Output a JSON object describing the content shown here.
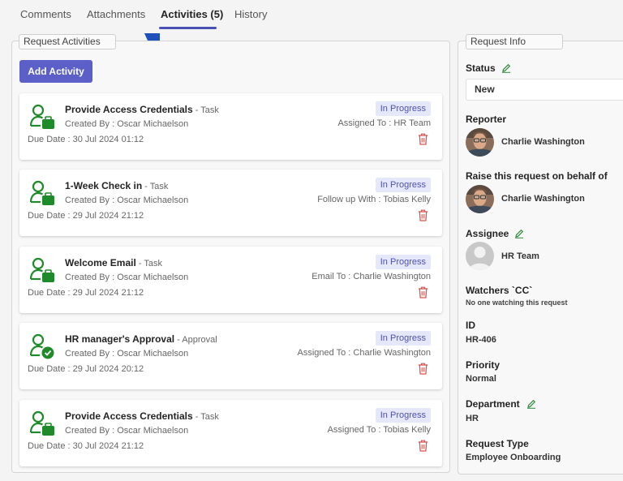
{
  "tabs": [
    {
      "label": "Comments"
    },
    {
      "label": "Attachments"
    },
    {
      "label": "Activities (5)"
    },
    {
      "label": "History"
    }
  ],
  "activities_panel": {
    "legend": "Request Activities",
    "add_button": "Add Activity",
    "items": [
      {
        "title": "Provide Access Credentials",
        "type": " - Task",
        "created": "Created By : Oscar Michaelson",
        "due": "Due Date : 30 Jul 2024 01:12",
        "status": "In Progress",
        "assign": "Assigned To : HR Team",
        "icon": "user-briefcase-icon"
      },
      {
        "title": "1-Week Check in",
        "type": " - Task",
        "created": "Created By : Oscar Michaelson",
        "due": "Due Date : 29 Jul 2024 21:12",
        "status": "In Progress",
        "assign": "Follow up With : Tobias Kelly",
        "icon": "user-briefcase-icon"
      },
      {
        "title": "Welcome Email",
        "type": " - Task",
        "created": "Created By : Oscar Michaelson",
        "due": "Due Date : 29 Jul 2024 21:12",
        "status": "In Progress",
        "assign": "Email To : Charlie Washington",
        "icon": "user-briefcase-icon"
      },
      {
        "title": "HR manager's Approval",
        "type": " - Approval",
        "created": "Created By : Oscar Michaelson",
        "due": "Due Date : 29 Jul 2024 20:12",
        "status": "In Progress",
        "assign": "Assigned To : Charlie Washington",
        "icon": "user-check-icon"
      },
      {
        "title": "Provide Access Credentials",
        "type": " - Task",
        "created": "Created By : Oscar Michaelson",
        "due": "Due Date : 30 Jul 2024 21:12",
        "status": "In Progress",
        "assign": "Assigned To : Tobias Kelly",
        "icon": "user-briefcase-icon"
      }
    ]
  },
  "request_info": {
    "legend": "Request Info",
    "status_label": "Status",
    "status_value": "New",
    "reporter_label": "Reporter",
    "reporter_name": "Charlie Washington",
    "behalf_label": "Raise this request on behalf of",
    "behalf_name": "Charlie Washington",
    "assignee_label": "Assignee",
    "assignee_name": "HR Team",
    "watchers_label": "Watchers `CC`",
    "watchers_value": "No one watching this request",
    "id_label": "ID",
    "id_value": "HR-406",
    "priority_label": "Priority",
    "priority_value": "Normal",
    "department_label": "Department",
    "department_value": "HR",
    "request_type_label": "Request Type",
    "request_type_value": "Employee Onboarding"
  },
  "colors": {
    "accent": "#5b5fc7",
    "icon_green": "#1f8a2a",
    "status_bg": "#e5e8fa",
    "status_text": "#4f52b2",
    "trash_red": "#d9534f",
    "pencil_green": "#2e8b3d"
  }
}
